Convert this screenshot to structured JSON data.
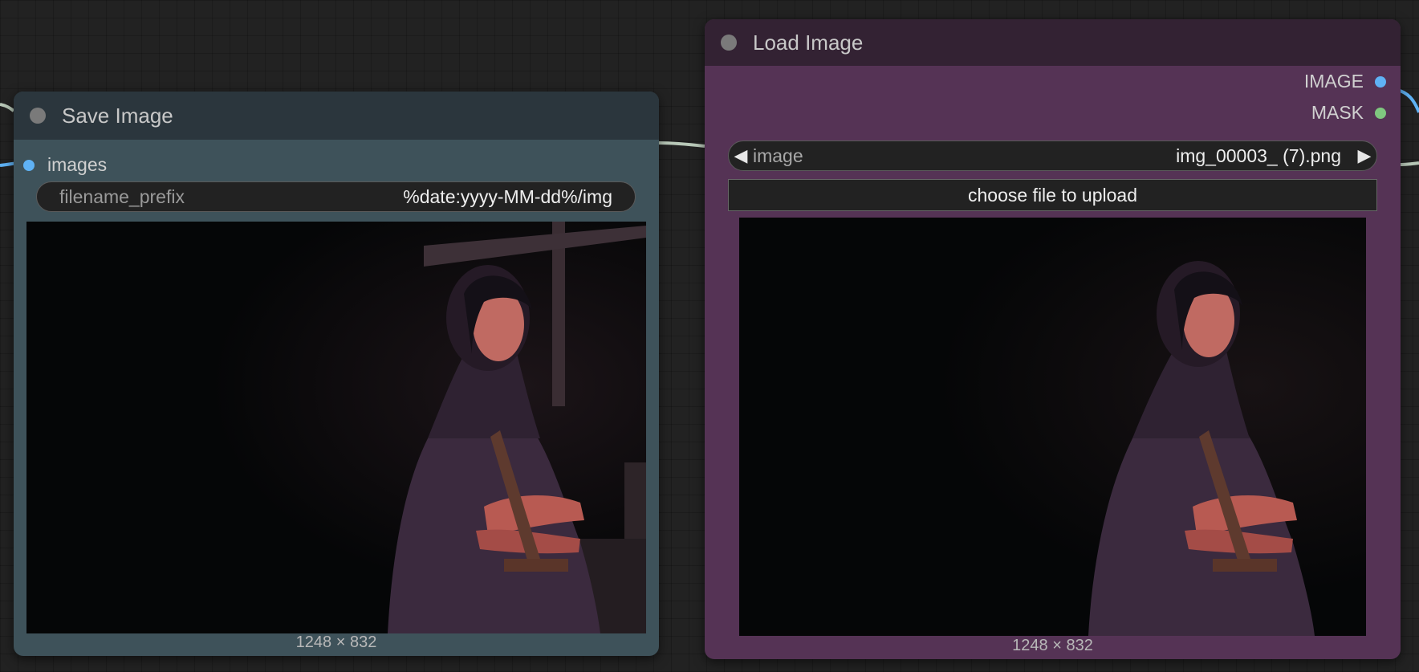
{
  "save_node": {
    "title": "Save Image",
    "input_label": "images",
    "widget": {
      "label": "filename_prefix",
      "value": "%date:yyyy-MM-dd%/img"
    },
    "dims": "1248 × 832"
  },
  "load_node": {
    "title": "Load Image",
    "outputs": [
      {
        "label": "IMAGE",
        "color": "#5fb2f5"
      },
      {
        "label": "MASK",
        "color": "#7fc77f"
      }
    ],
    "combo": {
      "label": "image",
      "value": "img_00003_ (7).png",
      "prev_icon": "◀",
      "next_icon": "▶"
    },
    "upload_label": "choose file to upload",
    "dims": "1248 × 832"
  },
  "colors": {
    "image_wire": "#5fb2f5",
    "generic_wire": "#b8c8b8"
  }
}
